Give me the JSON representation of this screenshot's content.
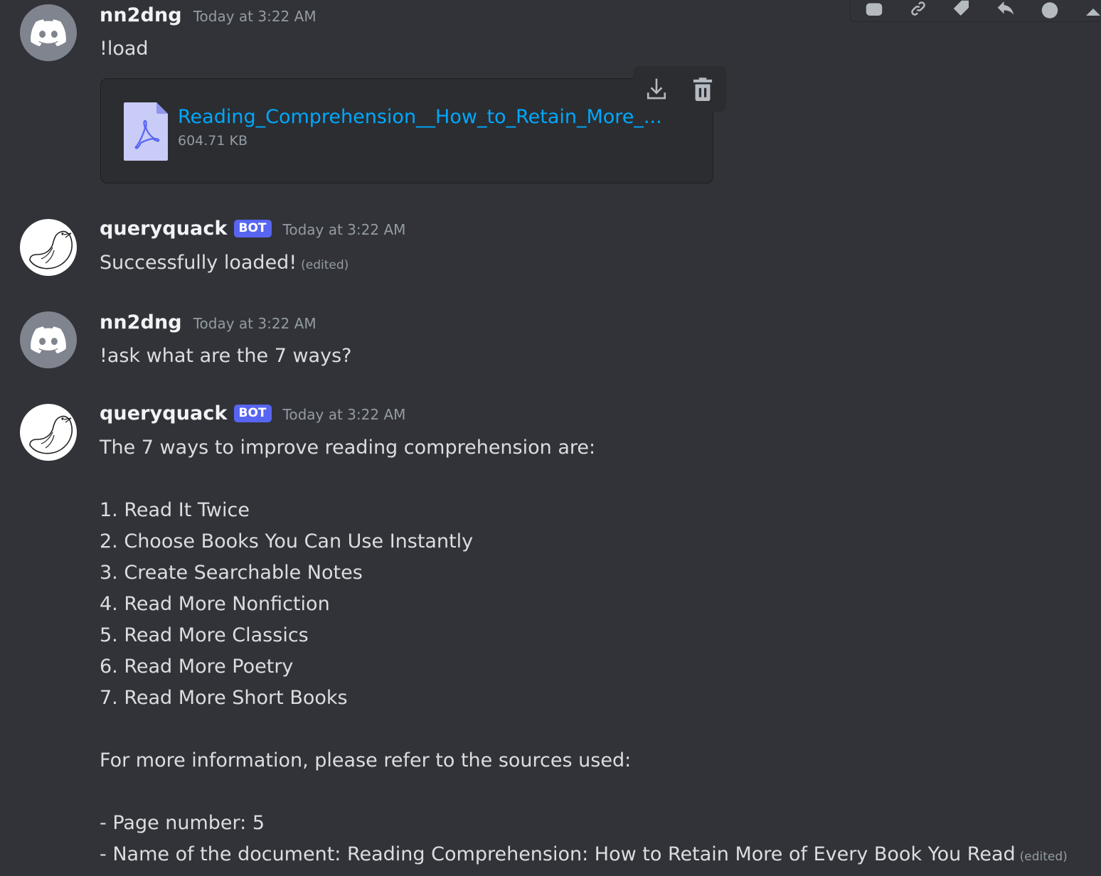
{
  "toolbar": {
    "icons": [
      "app-icon",
      "link-icon",
      "tag-icon",
      "reply-icon",
      "reaction-icon",
      "more-icon"
    ]
  },
  "messages": [
    {
      "username": "nn2dng",
      "timestamp": "Today at 3:22 AM",
      "text": "!load",
      "attachment": {
        "filename": "Reading_Comprehension__How_to_Retain_More_...",
        "size": "604.71 KB",
        "actions": [
          "download-icon",
          "delete-icon"
        ]
      }
    },
    {
      "username": "queryquack",
      "bot_tag": "BOT",
      "timestamp": "Today at 3:22 AM",
      "text": "Successfully loaded!",
      "edited": "(edited)"
    },
    {
      "username": "nn2dng",
      "timestamp": "Today at 3:22 AM",
      "text": "!ask what are the 7 ways?"
    },
    {
      "username": "queryquack",
      "bot_tag": "BOT",
      "timestamp": "Today at 3:22 AM",
      "lines": [
        "The 7 ways to improve reading comprehension are:",
        "",
        "1. Read It Twice",
        "2. Choose Books You Can Use Instantly",
        "3. Create Searchable Notes",
        "4. Read More Nonfiction",
        "5. Read More Classics",
        "6. Read More Poetry",
        "7. Read More Short Books",
        "",
        "For more information, please refer to the sources used:",
        "",
        "- Page number: 5",
        "- Name of the document: Reading Comprehension: How to Retain More of Every Book You Read"
      ],
      "edited": "(edited)"
    }
  ]
}
